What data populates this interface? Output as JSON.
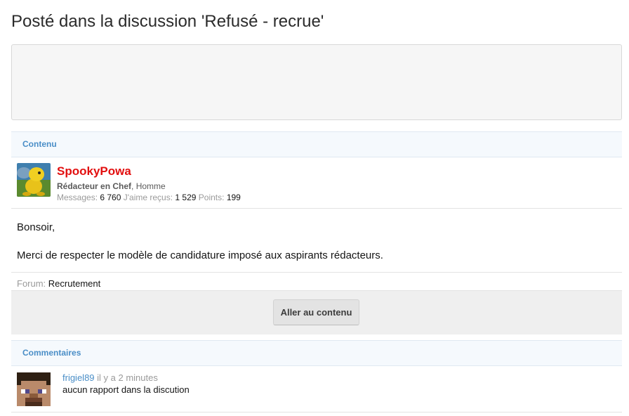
{
  "page": {
    "title": "Posté dans la discussion 'Refusé - recrue'"
  },
  "content": {
    "header": "Contenu",
    "author": {
      "username": "SpookyPowa",
      "role": "Rédacteur en Chef",
      "gender": ", Homme",
      "messages_label": "Messages:",
      "messages_value": "6 760",
      "likes_label": "J'aime reçus:",
      "likes_value": "1 529",
      "points_label": "Points:",
      "points_value": "199",
      "name_color": "#e20f0f"
    },
    "message_lines": [
      "Bonsoir,",
      "Merci de respecter le modèle de candidature imposé aux aspirants rédacteurs."
    ],
    "forum_label": "Forum:",
    "forum_value": "Recrutement",
    "goto_button": "Aller au contenu"
  },
  "comments": {
    "header": "Commentaires",
    "items": [
      {
        "username": "frigiel89",
        "time": "il y a 2 minutes",
        "text": "aucun rapport dans la discution"
      }
    ]
  },
  "colors": {
    "accent": "#4a8ec7",
    "header_bg": "#f5f9fd"
  }
}
